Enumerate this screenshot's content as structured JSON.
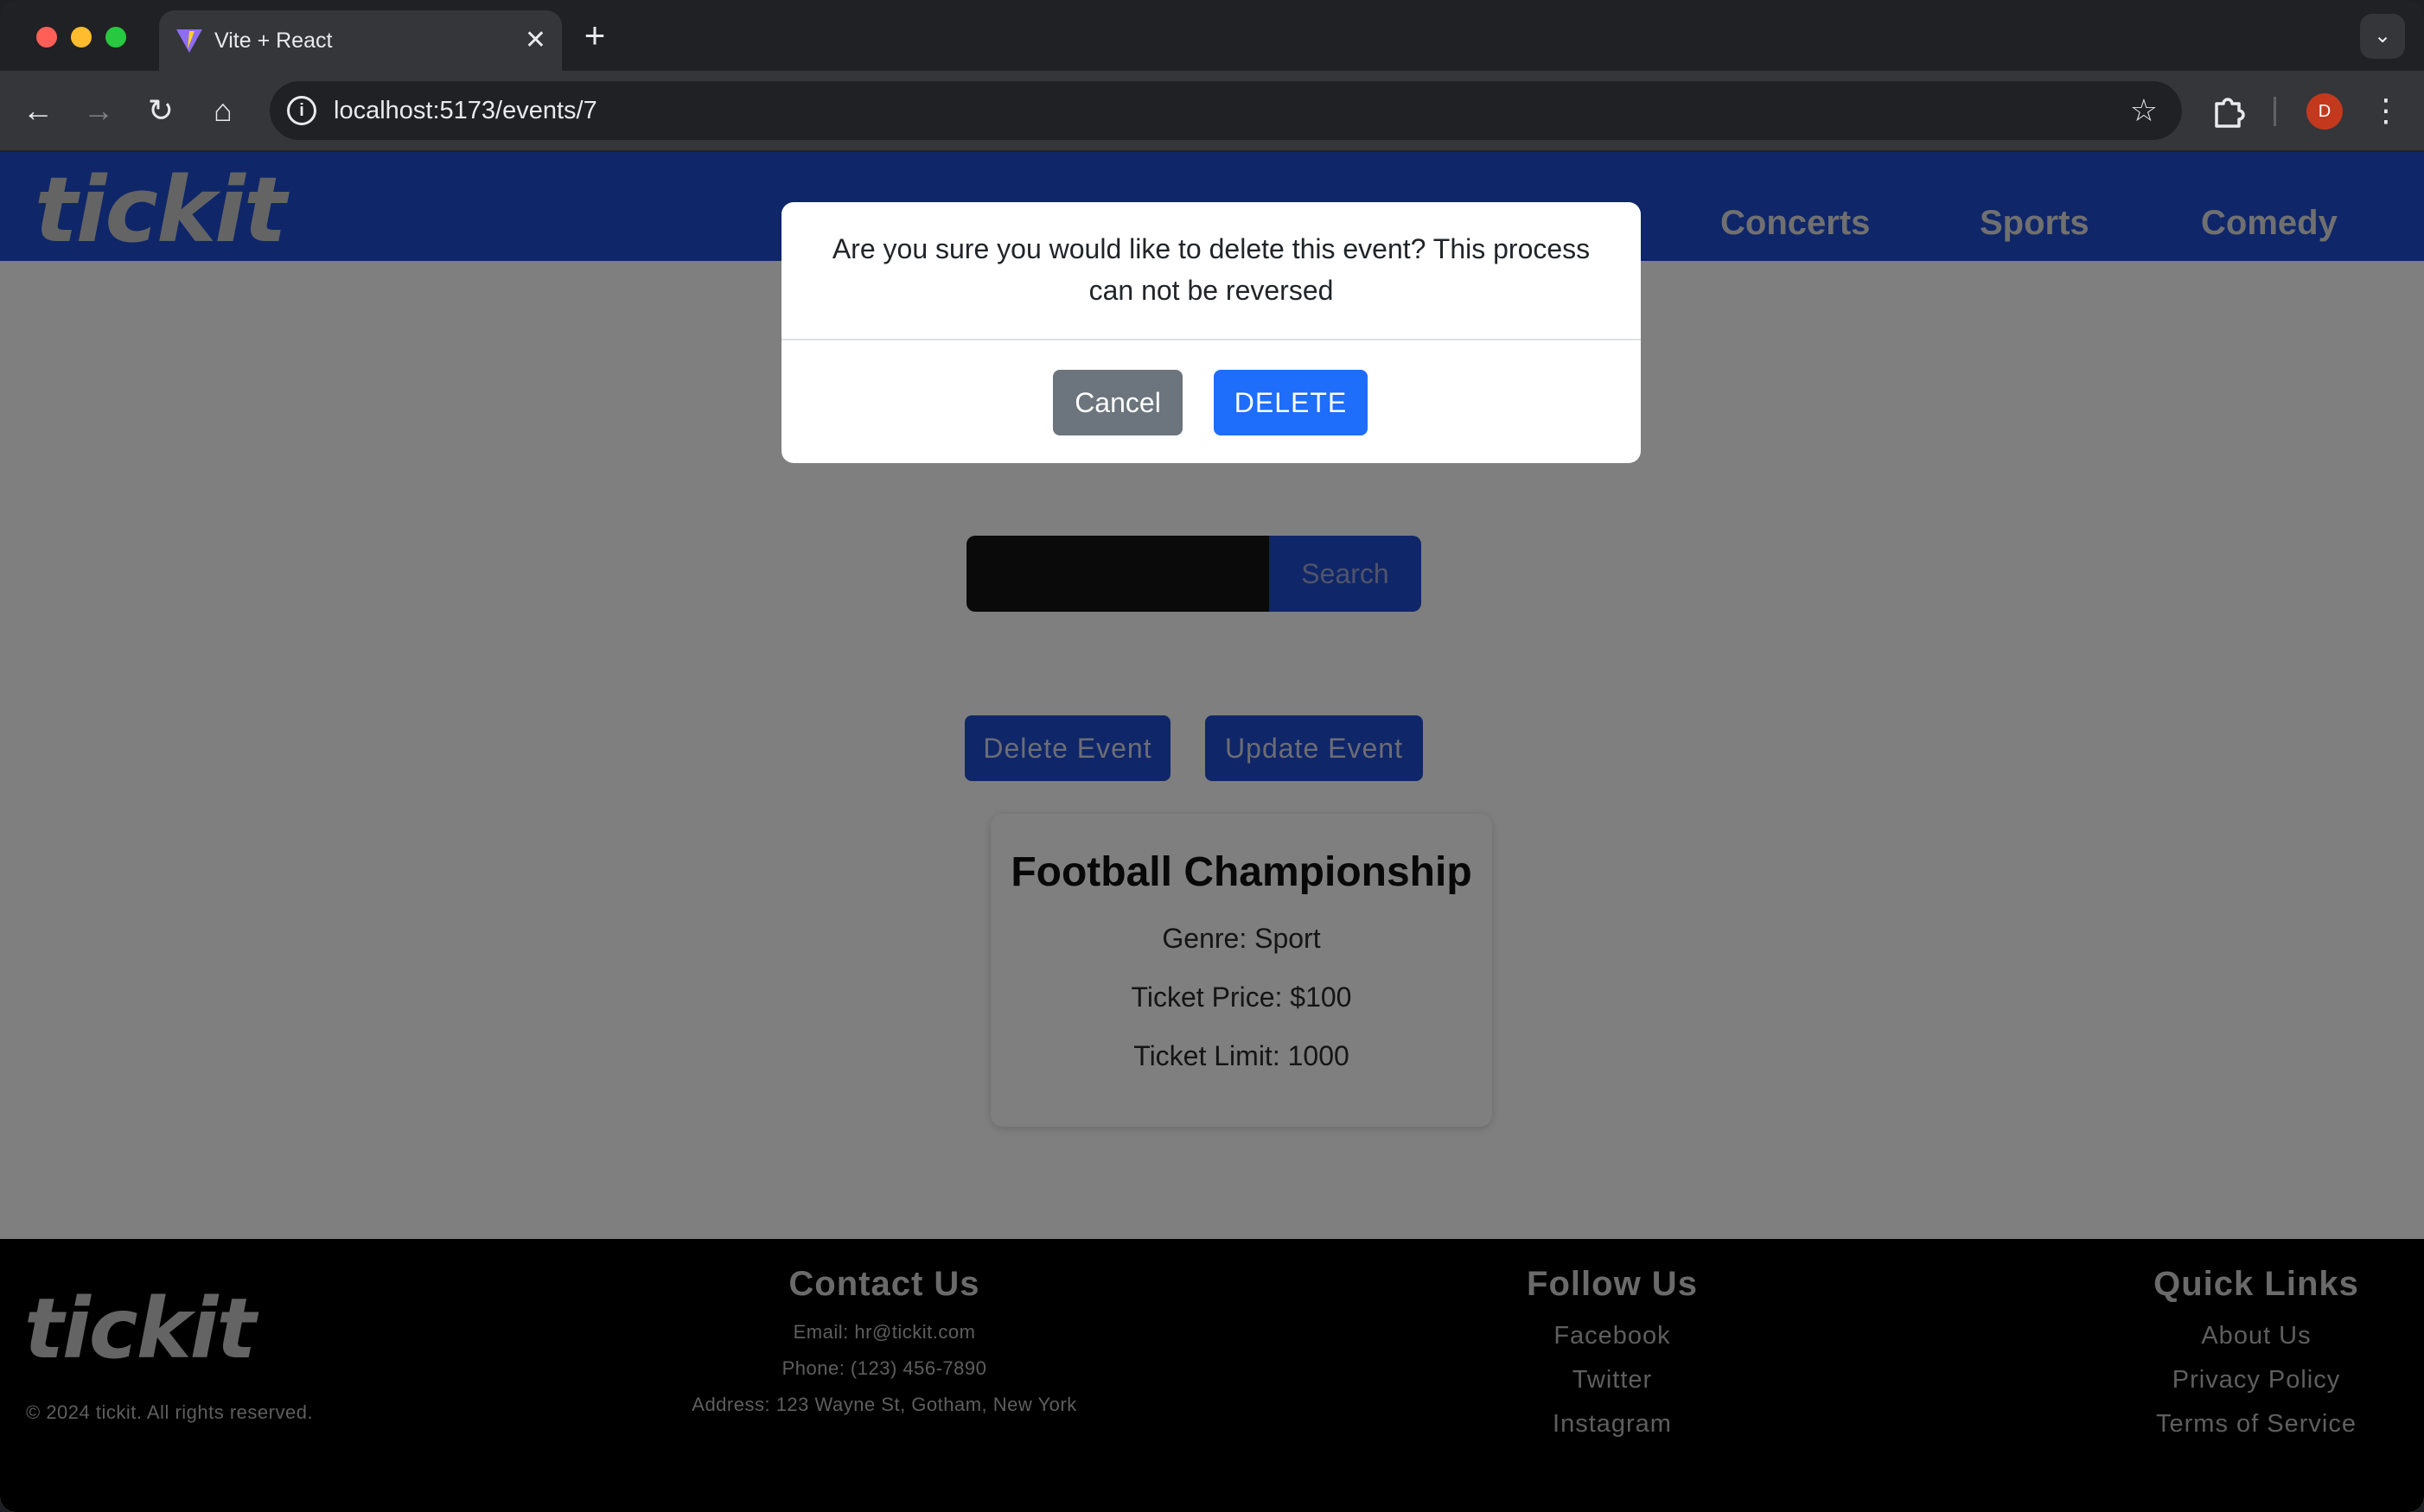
{
  "browser": {
    "tab_title": "Vite + React",
    "url": "localhost:5173/events/7",
    "profile_initial": "D"
  },
  "header": {
    "brand": "tickit",
    "nav": [
      "Concerts",
      "Sports",
      "Comedy"
    ]
  },
  "search": {
    "input_value": "",
    "button_label": "Search"
  },
  "actions": {
    "delete_label": "Delete Event",
    "update_label": "Update Event"
  },
  "event": {
    "title": "Football Championship",
    "genre": "Genre: Sport",
    "price": "Ticket Price: $100",
    "limit": "Ticket Limit: 1000"
  },
  "modal": {
    "message": "Are you sure you would like to delete this event? This process can not be reversed",
    "cancel_label": "Cancel",
    "delete_label": "DELETE"
  },
  "footer": {
    "brand": "tickit",
    "copyright": "© 2024 tickit. All rights reserved.",
    "contact": {
      "heading": "Contact Us",
      "email": "Email: hr@tickit.com",
      "phone": "Phone: (123) 456-7890",
      "address": "Address: 123 Wayne St, Gotham, New York"
    },
    "follow": {
      "heading": "Follow Us",
      "links": [
        "Facebook",
        "Twitter",
        "Instagram"
      ]
    },
    "quick": {
      "heading": "Quick Links",
      "links": [
        "About Us",
        "Privacy Policy",
        "Terms of Service"
      ]
    }
  },
  "colors": {
    "brand_blue": "#1e4dd2",
    "delete_button": "#1e6dfb",
    "cancel_button": "#6c757d"
  }
}
